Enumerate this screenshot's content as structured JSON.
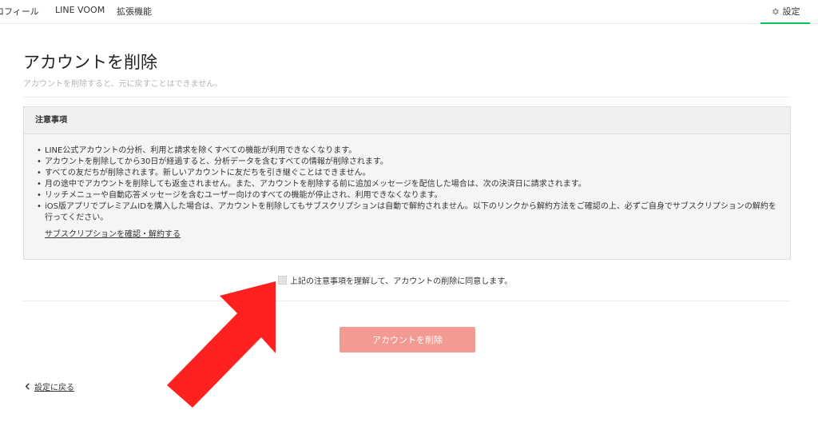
{
  "nav": {
    "tabs": [
      {
        "label": "ロフィール"
      },
      {
        "label": "LINE VOOM"
      },
      {
        "label": "拡張機能"
      }
    ],
    "settings_label": "設定"
  },
  "page": {
    "title": "アカウントを削除",
    "subtitle": "アカウントを削除すると、元に戻すことはできません。"
  },
  "notice": {
    "header": "注意事項",
    "items": [
      "LINE公式アカウントの分析、利用と請求を除くすべての機能が利用できなくなります。",
      "アカウントを削除してから30日が経過すると、分析データを含むすべての情報が削除されます。",
      "すべての友だちが削除されます。新しいアカウントに友だちを引き継ぐことはできません。",
      "月の途中でアカウントを削除しても返金されません。また、アカウントを削除する前に追加メッセージを配信した場合は、次の決済日に請求されます。",
      "リッチメニューや自動応答メッセージを含むユーザー向けのすべての機能が停止され、利用できなくなります。",
      "iOS版アプリでプレミアムIDを購入した場合は、アカウントを削除してもサブスクリプションは自動で解約されません。以下のリンクから解約方法をご確認の上、必ずご自身でサブスクリプションの解約を行ってください。"
    ],
    "link_label": "サブスクリプションを確認・解約する"
  },
  "agree": {
    "label": "上記の注意事項を理解して、アカウントの削除に同意します。",
    "checked": false
  },
  "delete_button": "アカウントを削除",
  "back_link": "設定に戻る",
  "colors": {
    "accent_green": "#06c755",
    "delete_button_bg": "#f39a93",
    "annotation_arrow": "#ff2020"
  }
}
